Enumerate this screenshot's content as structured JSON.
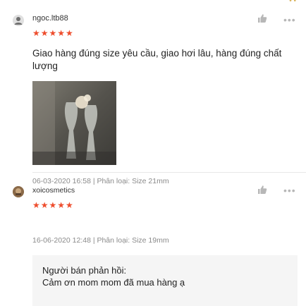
{
  "reviews": [
    {
      "username": "ngoc.ltb88",
      "stars": "★★★★★",
      "comment": "Giao hàng đúng size yêu cầu, giao hơi lâu, hàng đúng chất lượng",
      "meta": "06-03-2020 16:58 | Phân loại: Size 21mm",
      "icons": [
        "avatar",
        "star-icon",
        "like-icon",
        "more-icon"
      ]
    },
    {
      "username": "xoicosmetics",
      "stars": "★★★★★",
      "meta": "16-06-2020 12:48 | Phân loại: Size 19mm",
      "icons": [
        "avatar",
        "star-icon",
        "like-icon",
        "more-icon"
      ]
    }
  ],
  "seller_reply": {
    "title": "Người bán phản hồi:",
    "text": "Cảm ơn mom mom đã mua hàng ạ"
  },
  "more_label": "•••",
  "top_indicator": "• •",
  "colors": {
    "star": "#ee4d2d",
    "meta": "#8a8a8a",
    "reply_bg": "#f5f5f5"
  }
}
